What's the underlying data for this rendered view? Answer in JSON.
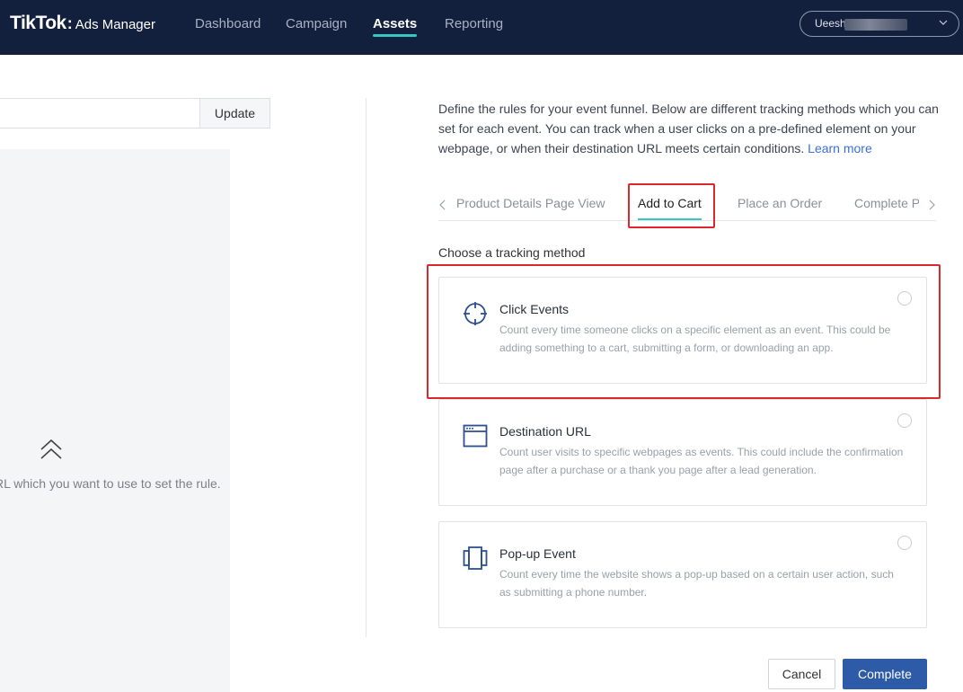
{
  "header": {
    "logo_brand": "TikTok",
    "logo_colon": ":",
    "logo_product": "Ads Manager",
    "nav": [
      {
        "label": "Dashboard",
        "active": false
      },
      {
        "label": "Campaign",
        "active": false
      },
      {
        "label": "Assets",
        "active": true
      },
      {
        "label": "Reporting",
        "active": false
      }
    ],
    "account_name": "Ueesh"
  },
  "left_panel": {
    "url_input_value": "",
    "update_label": "Update",
    "preview_hint": "RL which you want to use to set the rule."
  },
  "right_panel": {
    "description": "Define the rules for your event funnel. Below are different tracking methods which you can set for each event. You can track when a user clicks on a pre-defined element on your webpage, or when their destination URL meets certain conditions.",
    "learn_more": "Learn more",
    "tabs": [
      {
        "label": "Product Details Page View",
        "active": false
      },
      {
        "label": "Add to Cart",
        "active": true
      },
      {
        "label": "Place an Order",
        "active": false
      },
      {
        "label": "Complete Payment",
        "active": false
      }
    ],
    "choose_label": "Choose a tracking method",
    "methods": [
      {
        "title": "Click Events",
        "desc": "Count every time someone clicks on a specific element as an event. This could be adding something to a cart, submitting a form, or downloading an app.",
        "icon": "crosshair-icon",
        "selected": false
      },
      {
        "title": "Destination URL",
        "desc": "Count user visits to specific webpages as events. This could include the confirmation page after a purchase or a thank you page after a lead generation.",
        "icon": "browser-window-icon",
        "selected": false
      },
      {
        "title": "Pop-up Event",
        "desc": "Count every time the website shows a pop-up based on a certain user action, such as submitting a phone number.",
        "icon": "popup-icon",
        "selected": false
      }
    ]
  },
  "footer": {
    "cancel_label": "Cancel",
    "complete_label": "Complete"
  },
  "colors": {
    "topbar": "#13203d",
    "accent_teal": "#35c8c0",
    "primary_button": "#2d5ba8",
    "highlight_red": "#e0262d",
    "link": "#3a6fd8"
  }
}
